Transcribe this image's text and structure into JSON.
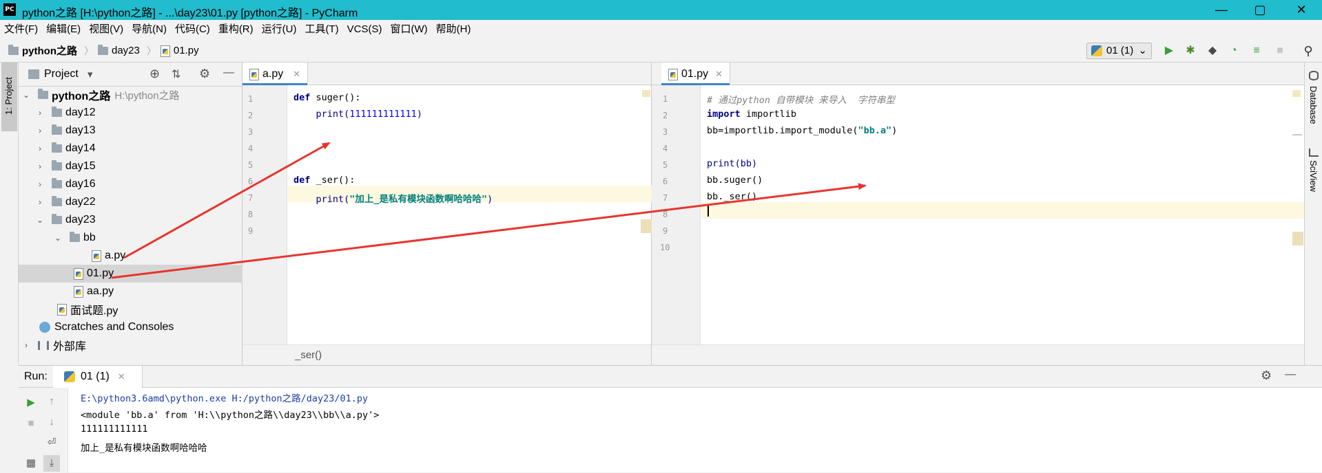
{
  "window": {
    "title": "python之路 [H:\\python之路] - ...\\day23\\01.py [python之路] - PyCharm",
    "app_icon_text": "PC",
    "minimize": "—",
    "maximize": "▢",
    "close": "✕"
  },
  "menu": [
    "文件(F)",
    "编辑(E)",
    "视图(V)",
    "导航(N)",
    "代码(C)",
    "重构(R)",
    "运行(U)",
    "工具(T)",
    "VCS(S)",
    "窗口(W)",
    "帮助(H)"
  ],
  "breadcrumb": {
    "project": "python之路",
    "folder": "day23",
    "file": "01.py"
  },
  "run_config": {
    "label": "01 (1)",
    "arrow": "⌄"
  },
  "toolbar_icons": {
    "run": "▶",
    "debug": "✱",
    "coverage": "◆",
    "profile": "◔",
    "build": "≡",
    "stop": "■",
    "search": "⚲"
  },
  "left_strip": {
    "project_tab": "1: Project"
  },
  "right_strip": {
    "database": "Database",
    "sciview": "SciView"
  },
  "project_panel": {
    "header_label": "Project",
    "header_arrow": "▾",
    "icons": {
      "locate": "⊕",
      "collapse": "⇅",
      "settings": "⚙",
      "hide": "—"
    },
    "tree": [
      {
        "label": "python之路",
        "path": "H:\\python之路",
        "chev": "⌄"
      },
      {
        "label": "day12",
        "chev": "›"
      },
      {
        "label": "day13",
        "chev": "›"
      },
      {
        "label": "day14",
        "chev": "›"
      },
      {
        "label": "day15",
        "chev": "›"
      },
      {
        "label": "day16",
        "chev": "›"
      },
      {
        "label": "day22",
        "chev": "›"
      },
      {
        "label": "day23",
        "chev": "⌄"
      },
      {
        "label": "bb",
        "chev": "⌄"
      },
      {
        "label": "a.py"
      },
      {
        "label": "01.py"
      },
      {
        "label": "aa.py"
      },
      {
        "label": "面试题.py"
      },
      {
        "label": "Scratches and Consoles"
      },
      {
        "label": "外部库",
        "chev": "›"
      }
    ]
  },
  "editor_left": {
    "tab": "a.py",
    "tab_close": "✕",
    "line_numbers": [
      "1",
      "2",
      "3",
      "4",
      "5",
      "6",
      "7",
      "8",
      "9"
    ],
    "lines": {
      "l1_kw": "def",
      "l1_rest": " suger():",
      "l2_fn": "    print(",
      "l2_num": "111111111111",
      "l2_end": ")",
      "l6_kw": "def",
      "l6_rest": " _ser():",
      "l7_fn": "    print(",
      "l7_str": "\"加上_是私有模块函数啊哈哈哈\"",
      "l7_end": ")"
    },
    "breadcrumb": "_ser()"
  },
  "editor_right": {
    "tab": "01.py",
    "tab_close": "✕",
    "line_numbers": [
      "1",
      "2",
      "3",
      "4",
      "5",
      "6",
      "7",
      "8",
      "9",
      "10"
    ],
    "lines": {
      "l1": "# 通过python 自带模块 来导入  字符串型",
      "l2_kw": "import",
      "l2_rest": " importlib",
      "l3_a": "bb=importlib.import_module(",
      "l3_str": "\"bb.a\"",
      "l3_end": ")",
      "l5": "print(bb)",
      "l6": "bb.suger()",
      "l7": "bb._ser()"
    }
  },
  "run_panel": {
    "label": "Run:",
    "tab": "01 (1)",
    "tab_close": "✕",
    "settings": "⚙",
    "hide": "—",
    "output": [
      "E:\\python3.6amd\\python.exe H:/python之路/day23/01.py",
      "<module 'bb.a' from 'H:\\\\python之路\\\\day23\\\\bb\\\\a.py'>",
      "111111111111",
      "加上_是私有模块函数啊哈哈哈"
    ],
    "tools": {
      "run": "▶",
      "stop": "■",
      "up": "↑",
      "down": "↓",
      "wrap": "⏎",
      "layout": "▦",
      "scroll": "⤓"
    }
  },
  "colors": {
    "titlebar": "#21bccd",
    "annotation_arrow": "#e8342e",
    "keyword": "#000080",
    "number": "#0000ff",
    "string": "#008080",
    "comment": "#808080"
  }
}
